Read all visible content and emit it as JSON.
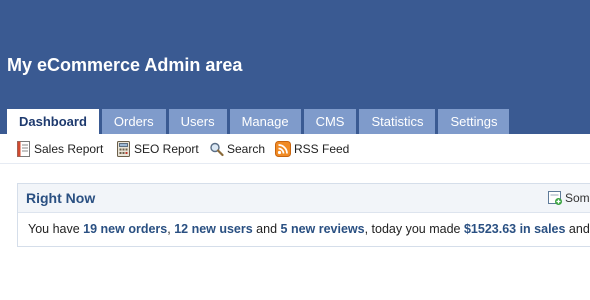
{
  "header": {
    "title": "My eCommerce Admin area"
  },
  "tabs": [
    {
      "label": "Dashboard",
      "active": true
    },
    {
      "label": "Orders"
    },
    {
      "label": "Users"
    },
    {
      "label": "Manage"
    },
    {
      "label": "CMS"
    },
    {
      "label": "Statistics"
    },
    {
      "label": "Settings"
    }
  ],
  "subnav": [
    {
      "label": "Sales Report",
      "icon": "report-icon"
    },
    {
      "label": "SEO Report",
      "icon": "calculator-icon"
    },
    {
      "label": "Search",
      "icon": "magnifier-icon"
    },
    {
      "label": "RSS Feed",
      "icon": "rss-icon"
    }
  ],
  "panel": {
    "title": "Right Now",
    "action_label": "Som",
    "summary": {
      "prefix": "You have ",
      "orders": "19 new orders",
      "sep1": ", ",
      "users": "12 new users",
      "sep2": " and ",
      "reviews": "5 new reviews",
      "middle": ", today you made ",
      "sales": "$1523.63 in sales",
      "suffix": " and a t"
    }
  },
  "colors": {
    "header_bg": "#3a5a92",
    "tab_bg": "#7f9bcb",
    "accent": "#2a5082"
  }
}
